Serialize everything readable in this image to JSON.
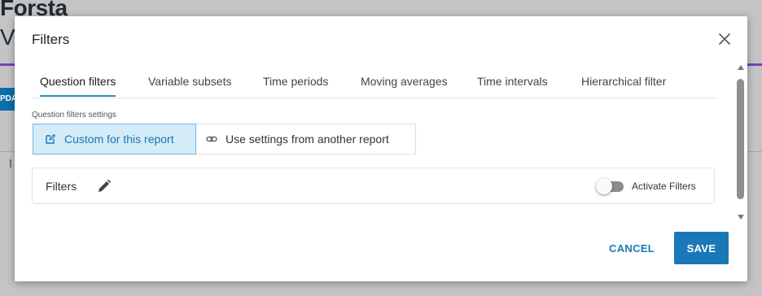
{
  "background": {
    "logo": "Forsta",
    "letter": "V",
    "tag": "PDA"
  },
  "modal": {
    "title": "Filters",
    "tabs": [
      {
        "label": "Question filters",
        "active": true
      },
      {
        "label": "Variable subsets",
        "active": false
      },
      {
        "label": "Time periods",
        "active": false
      },
      {
        "label": "Moving averages",
        "active": false
      },
      {
        "label": "Time intervals",
        "active": false
      },
      {
        "label": "Hierarchical filter",
        "active": false
      }
    ],
    "settings_label": "Question filters settings",
    "options": {
      "custom": "Custom for this report",
      "other": "Use settings from another report",
      "selected": "custom"
    },
    "filters": {
      "label": "Filters",
      "toggle_label": "Activate Filters",
      "toggle_on": false
    },
    "buttons": {
      "cancel": "CANCEL",
      "save": "SAVE"
    }
  },
  "colors": {
    "accent": "#1b78b8",
    "selected_bg": "#d4ecf8",
    "tab_underline": "#2a8bc6"
  },
  "icons": {
    "close": "close-icon",
    "edit": "edit-square-icon",
    "link": "link-icon",
    "pencil": "pencil-icon"
  }
}
